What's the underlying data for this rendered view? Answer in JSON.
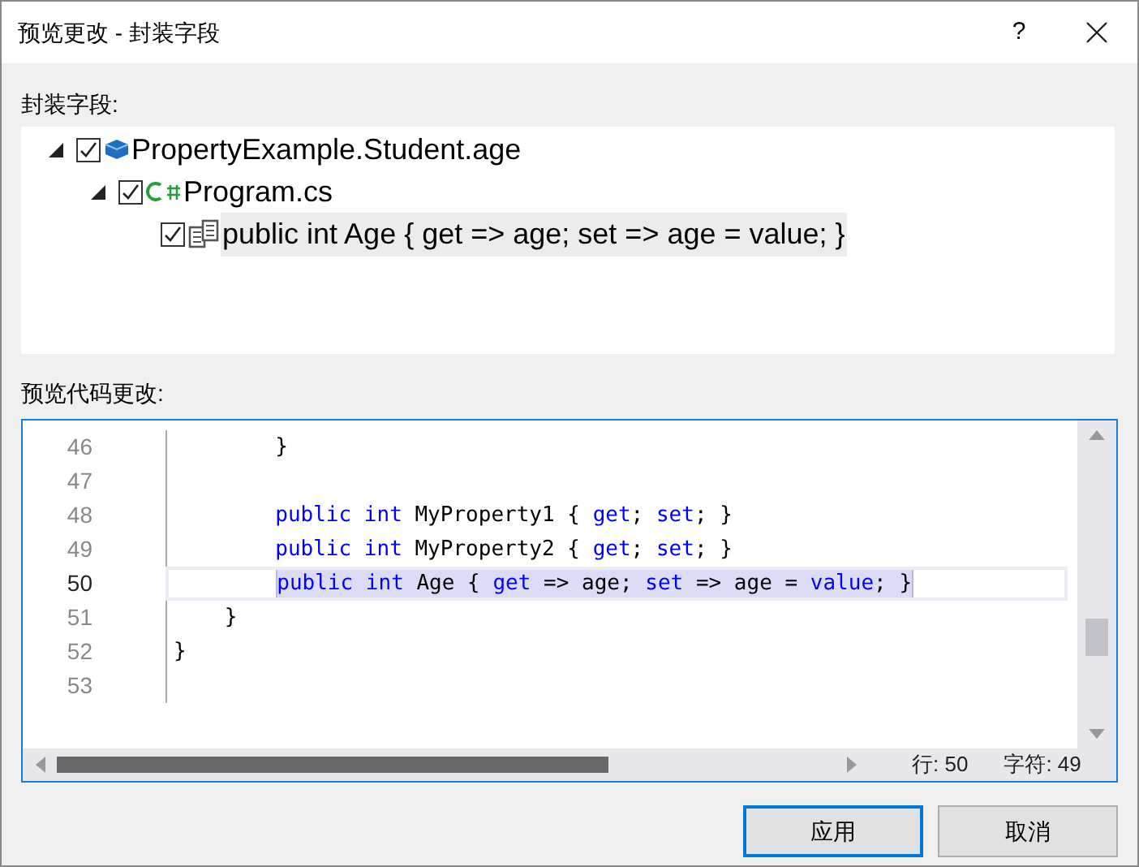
{
  "window": {
    "title": "预览更改 - 封装字段",
    "help": "?"
  },
  "tree_label": "封装字段:",
  "tree": [
    {
      "kind": "field",
      "label": "PropertyExample.Student.age",
      "checked": true,
      "expanded": true,
      "children": [
        {
          "kind": "file",
          "label": "Program.cs",
          "checked": true,
          "expanded": true,
          "children": [
            {
              "kind": "property",
              "label": "public int Age { get => age; set => age = value; }",
              "checked": true,
              "selected": true
            }
          ]
        }
      ]
    }
  ],
  "preview_label": "预览代码更改:",
  "code_lines": [
    {
      "number": "46",
      "tokens": [
        {
          "text": "        }",
          "kind": "plain"
        }
      ],
      "selected": false
    },
    {
      "number": "47",
      "selected": false
    },
    {
      "number": "48",
      "tokens": [
        {
          "text": "        public",
          "kind": "keyword"
        },
        {
          "text": " int",
          "kind": "keyword"
        },
        {
          "text": " MyProperty1 { ",
          "kind": "plain"
        },
        {
          "text": "get",
          "kind": "keyword"
        },
        {
          "text": "; ",
          "kind": "plain"
        },
        {
          "text": "set",
          "kind": "keyword"
        },
        {
          "text": "; }",
          "kind": "plain"
        }
      ],
      "selected": false
    },
    {
      "number": "49",
      "tokens": [
        {
          "text": "        public",
          "kind": "keyword"
        },
        {
          "text": " int",
          "kind": "keyword"
        },
        {
          "text": " MyProperty2 { ",
          "kind": "plain"
        },
        {
          "text": "get",
          "kind": "keyword"
        },
        {
          "text": "; ",
          "kind": "plain"
        },
        {
          "text": "set",
          "kind": "keyword"
        },
        {
          "text": "; }",
          "kind": "plain"
        }
      ],
      "selected": false
    },
    {
      "number": "50",
      "tokens": [
        {
          "text": "        public",
          "kind": "keyword"
        },
        {
          "text": " int",
          "kind": "keyword"
        },
        {
          "text": " Age { ",
          "kind": "plain"
        },
        {
          "text": "get",
          "kind": "keyword"
        },
        {
          "text": " => age; ",
          "kind": "plain"
        },
        {
          "text": "set",
          "kind": "keyword"
        },
        {
          "text": " => age = ",
          "kind": "plain"
        },
        {
          "text": "value",
          "kind": "keyword"
        },
        {
          "text": "; }",
          "kind": "plain"
        }
      ],
      "selected": true
    },
    {
      "number": "51",
      "tokens": [
        {
          "text": "    }",
          "kind": "plain"
        }
      ],
      "selected": false
    },
    {
      "number": "52",
      "tokens": [
        {
          "text": "}",
          "kind": "plain"
        }
      ],
      "selected": false
    },
    {
      "number": "53",
      "selected": false
    }
  ],
  "status": {
    "line": "行: 50",
    "char": "字符: 49"
  },
  "buttons": [
    {
      "label": "应用",
      "default": true
    },
    {
      "label": "取消",
      "default": false
    }
  ]
}
